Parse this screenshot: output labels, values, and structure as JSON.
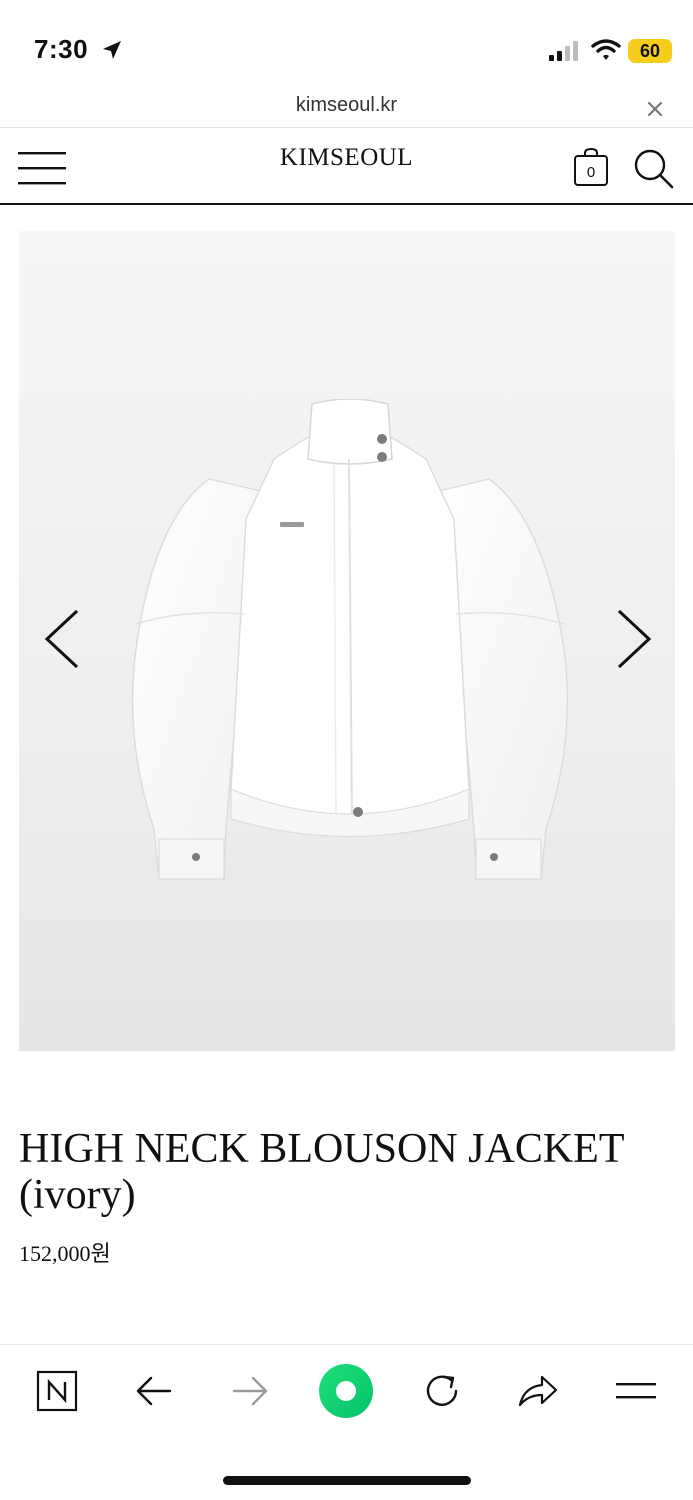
{
  "status_bar": {
    "time": "7:30",
    "battery_level": "60",
    "battery_color": "#f5cd1c",
    "icons": [
      "location-arrow-icon",
      "cellular-signal-icon",
      "wifi-icon",
      "battery-icon"
    ]
  },
  "browser": {
    "url": "kimseoul.kr",
    "close_icon": "close-icon"
  },
  "header": {
    "brand": "KIMSEOUL",
    "cart_count": "0",
    "icons": [
      "hamburger-menu-icon",
      "shopping-bag-icon",
      "search-icon"
    ]
  },
  "product": {
    "image_alt_color": "#ffffff",
    "title": "HIGH NECK BLOUSON JACKET (ivory)",
    "price": "152,000원",
    "gallery_icons": [
      "chevron-left-icon",
      "chevron-right-icon"
    ]
  },
  "toolbar": {
    "items": [
      "naver-logo-icon",
      "back-arrow-icon",
      "forward-arrow-icon",
      "green-dot-icon",
      "reload-icon",
      "share-icon",
      "menu-lines-icon"
    ],
    "accent_color": "#10d06b"
  }
}
